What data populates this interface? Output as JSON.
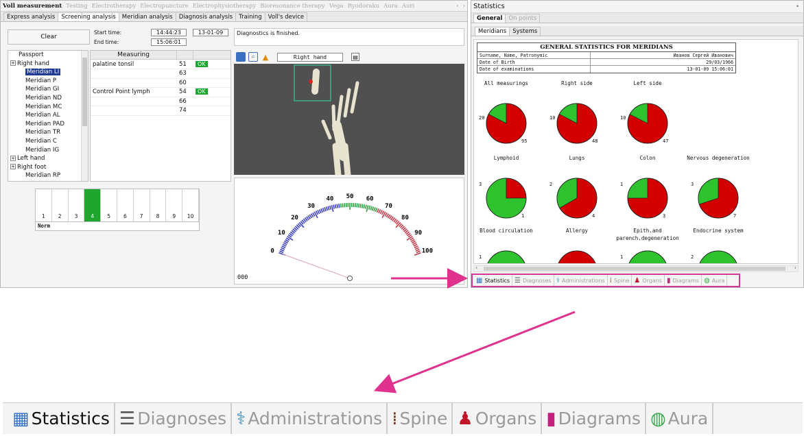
{
  "voll": {
    "top_menu": [
      "Voll measurement",
      "Testing",
      "Electrotherapy",
      "Electropuncture",
      "Electrophysiotherapy",
      "Bioresonance therapy",
      "Vega",
      "Ryodoraku",
      "Aura",
      "Auri"
    ],
    "tabs": [
      "Express analysis",
      "Screening analysis",
      "Meridian analysis",
      "Diagnosis analysis",
      "Training",
      "Voll's device"
    ],
    "clear_label": "Clear",
    "start_label": "Start time:",
    "start_time": "14:44:23",
    "start_date": "13-01-09",
    "end_label": "End time:",
    "end_time": "15:06:01",
    "status": "Diagnostics is finished.",
    "tree": [
      {
        "label": "Passport",
        "type": "leaf"
      },
      {
        "label": "Right hand",
        "type": "group"
      },
      {
        "label": "Meridian LI",
        "type": "child",
        "selected": true
      },
      {
        "label": "Meridian P",
        "type": "child"
      },
      {
        "label": "Meridian GI",
        "type": "child"
      },
      {
        "label": "Meridian ND",
        "type": "child"
      },
      {
        "label": "Meridian MC",
        "type": "child"
      },
      {
        "label": "Meridian AL",
        "type": "child"
      },
      {
        "label": "Meridian PAD",
        "type": "child"
      },
      {
        "label": "Meridian TR",
        "type": "child"
      },
      {
        "label": "Meridian C",
        "type": "child"
      },
      {
        "label": "Meridian IG",
        "type": "child"
      },
      {
        "label": "Left hand",
        "type": "group"
      },
      {
        "label": "Right foot",
        "type": "group"
      },
      {
        "label": "Meridian RP",
        "type": "child"
      }
    ],
    "measuring_header": "Measuring",
    "measurements": [
      {
        "name": "palatine tonsil",
        "value": "51",
        "status": "OK"
      },
      {
        "name": "",
        "value": "63",
        "status": ""
      },
      {
        "name": "",
        "value": "60",
        "status": ""
      },
      {
        "name": "Control Point lymph",
        "value": "54",
        "status": "OK"
      },
      {
        "name": "",
        "value": "66",
        "status": ""
      },
      {
        "name": "",
        "value": "74",
        "status": ""
      }
    ],
    "scale": [
      "1",
      "2",
      "3",
      "4",
      "5",
      "6",
      "7",
      "8",
      "9",
      "10"
    ],
    "scale_active": 4,
    "scale_label": "Norm",
    "view_label": "Right hand",
    "gauge_ticks": [
      "0",
      "10",
      "20",
      "30",
      "40",
      "50",
      "60",
      "70",
      "80",
      "90",
      "100"
    ],
    "gauge_value_text": "000"
  },
  "statistics": {
    "title": "Statistics",
    "tabs": [
      "General",
      "On points"
    ],
    "subtabs": [
      "Meridians",
      "Systems"
    ],
    "report_title": "GENERAL STATISTICS FOR MERIDIANS",
    "rows": [
      {
        "label": "Surname, Name, Patronymic",
        "value": "Иванов Сергей Иванович"
      },
      {
        "label": "Date of Birth",
        "value": "29/03/1966"
      },
      {
        "label": "Date of examinations",
        "value": "13-01-09 15:06:01"
      }
    ],
    "pies": [
      {
        "label": "All measurings",
        "green": 20,
        "red": 95
      },
      {
        "label": "Right side",
        "green": 10,
        "red": 48
      },
      {
        "label": "Left side",
        "green": 10,
        "red": 47
      },
      {
        "label": "Lymphoid",
        "green": 3,
        "red": 1
      },
      {
        "label": "Lungs",
        "green": 2,
        "red": 4
      },
      {
        "label": "Colon",
        "green": 1,
        "red": 3
      },
      {
        "label": "Nervous degeneration",
        "green": 3,
        "red": 7
      },
      {
        "label": "Blood circulation",
        "green": 1,
        "red": 0
      },
      {
        "label": "Allergy",
        "green": 0,
        "red": 0
      },
      {
        "label": "Epith.and parench.degeneration",
        "green": 1,
        "red": 0
      },
      {
        "label": "Endocrine system",
        "green": 2,
        "red": 0
      }
    ],
    "bottom_tabs": [
      "Statistics",
      "Diagnoses",
      "Administrations",
      "Spine",
      "Organs",
      "Diagrams",
      "Aura"
    ]
  },
  "colors": {
    "accent_arrow": "#e0318f",
    "ok_green": "#1fa52e",
    "pie_green": "#2ec22e",
    "pie_red": "#d40000"
  }
}
